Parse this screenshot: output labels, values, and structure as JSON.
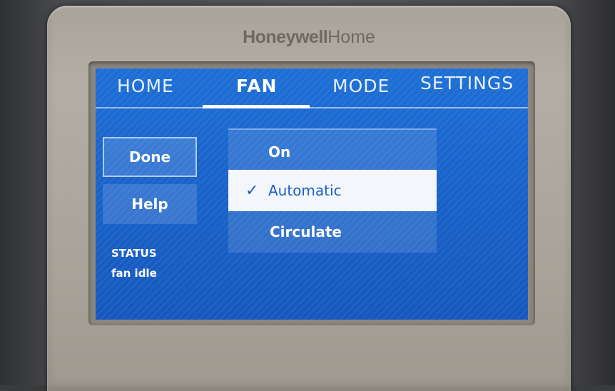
{
  "brand": {
    "name_bold": "Honeywell",
    "name_light": "Home"
  },
  "nav": {
    "tabs": [
      {
        "label": "HOME",
        "active": false
      },
      {
        "label": "FAN",
        "active": true
      },
      {
        "label": "MODE",
        "active": false
      },
      {
        "label": "SETTINGS",
        "active": false
      }
    ]
  },
  "sidebar": {
    "done_label": "Done",
    "help_label": "Help",
    "status_label": "STATUS",
    "status_value": "fan idle"
  },
  "fan_options": {
    "items": [
      {
        "label": "On",
        "selected": false
      },
      {
        "label": "Automatic",
        "selected": true
      },
      {
        "label": "Circulate",
        "selected": false
      }
    ],
    "check_glyph": "✓"
  },
  "colors": {
    "screen_blue": "#1a64cc",
    "bezel": "#aca79c",
    "selected_bg": "#f3f6fb",
    "selected_text": "#1b5fc4"
  }
}
